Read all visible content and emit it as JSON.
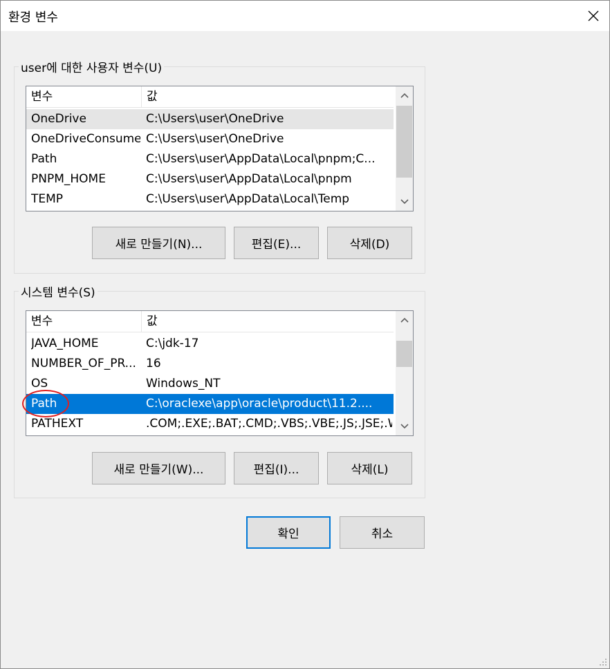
{
  "window": {
    "title": "환경 변수",
    "close_icon": "close-icon"
  },
  "user_vars": {
    "group_label": "user에 대한 사용자 변수(U)",
    "columns": {
      "name": "변수",
      "value": "값"
    },
    "rows": [
      {
        "name": "OneDrive",
        "value": "C:\\Users\\user\\OneDrive"
      },
      {
        "name": "OneDriveConsumer",
        "value": "C:\\Users\\user\\OneDrive"
      },
      {
        "name": "Path",
        "value": "C:\\Users\\user\\AppData\\Local\\pnpm;C..."
      },
      {
        "name": "PNPM_HOME",
        "value": "C:\\Users\\user\\AppData\\Local\\pnpm"
      },
      {
        "name": "TEMP",
        "value": "C:\\Users\\user\\AppData\\Local\\Temp"
      }
    ],
    "buttons": {
      "new": "새로 만들기(N)...",
      "edit": "편집(E)...",
      "delete": "삭제(D)"
    }
  },
  "system_vars": {
    "group_label": "시스템 변수(S)",
    "columns": {
      "name": "변수",
      "value": "값"
    },
    "rows": [
      {
        "name": "JAVA_HOME",
        "value": "C:\\jdk-17"
      },
      {
        "name": "NUMBER_OF_PR...",
        "value": "16"
      },
      {
        "name": "OS",
        "value": "Windows_NT"
      },
      {
        "name": "Path",
        "value": "C:\\oraclexe\\app\\oracle\\product\\11.2...."
      },
      {
        "name": "PATHEXT",
        "value": ".COM;.EXE;.BAT;.CMD;.VBS;.VBE;.JS;.JSE;.W..."
      }
    ],
    "selected_row": "Path",
    "buttons": {
      "new": "새로 만들기(W)...",
      "edit": "편집(I)...",
      "delete": "삭제(L)"
    }
  },
  "dialog_buttons": {
    "ok": "확인",
    "cancel": "취소"
  },
  "colors": {
    "selection": "#0078d7",
    "annotation": "#e02020",
    "hover": "#e5e5e5"
  }
}
